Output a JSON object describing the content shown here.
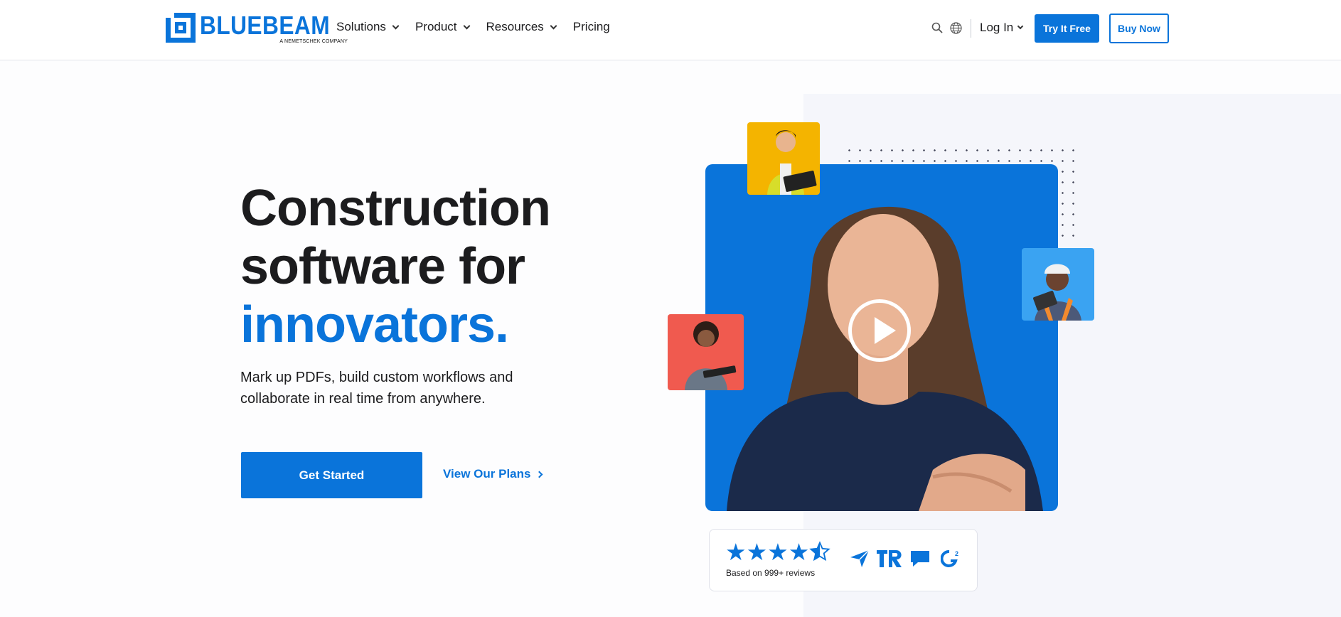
{
  "header": {
    "logo": {
      "wordmark": "BLUEBEAM",
      "tagline": "A NEMETSCHEK COMPANY"
    },
    "nav": [
      {
        "label": "Solutions",
        "has_dropdown": true
      },
      {
        "label": "Product",
        "has_dropdown": true
      },
      {
        "label": "Resources",
        "has_dropdown": true
      },
      {
        "label": "Pricing",
        "has_dropdown": false
      }
    ],
    "login_label": "Log In",
    "try_label": "Try It Free",
    "buy_label": "Buy Now",
    "icons": [
      "search-icon",
      "globe-icon"
    ]
  },
  "hero": {
    "title_line1": "Construction",
    "title_line2": "software for",
    "title_accent": "innovators.",
    "subtitle": "Mark up PDFs, build custom workflows and collaborate in real time from anywhere.",
    "cta_primary": "Get Started",
    "cta_secondary": "View Our Plans"
  },
  "media": {
    "video_icon": "play-icon",
    "thumbnails": [
      "worker-yellow-vest-photo",
      "worker-hardhat-photo",
      "woman-tablet-photo"
    ]
  },
  "reviews": {
    "rating_stars": 4.5,
    "stars_display": "★★★★",
    "text": "Based on 999+ reviews",
    "source_icons": [
      "capterra-icon",
      "trustradius-icon",
      "software-advice-icon",
      "g2-icon"
    ]
  },
  "colors": {
    "accent": "#0a74da",
    "thumb_yellow": "#f4b400",
    "thumb_blue": "#3aa3f2",
    "thumb_red": "#f05a4f"
  }
}
